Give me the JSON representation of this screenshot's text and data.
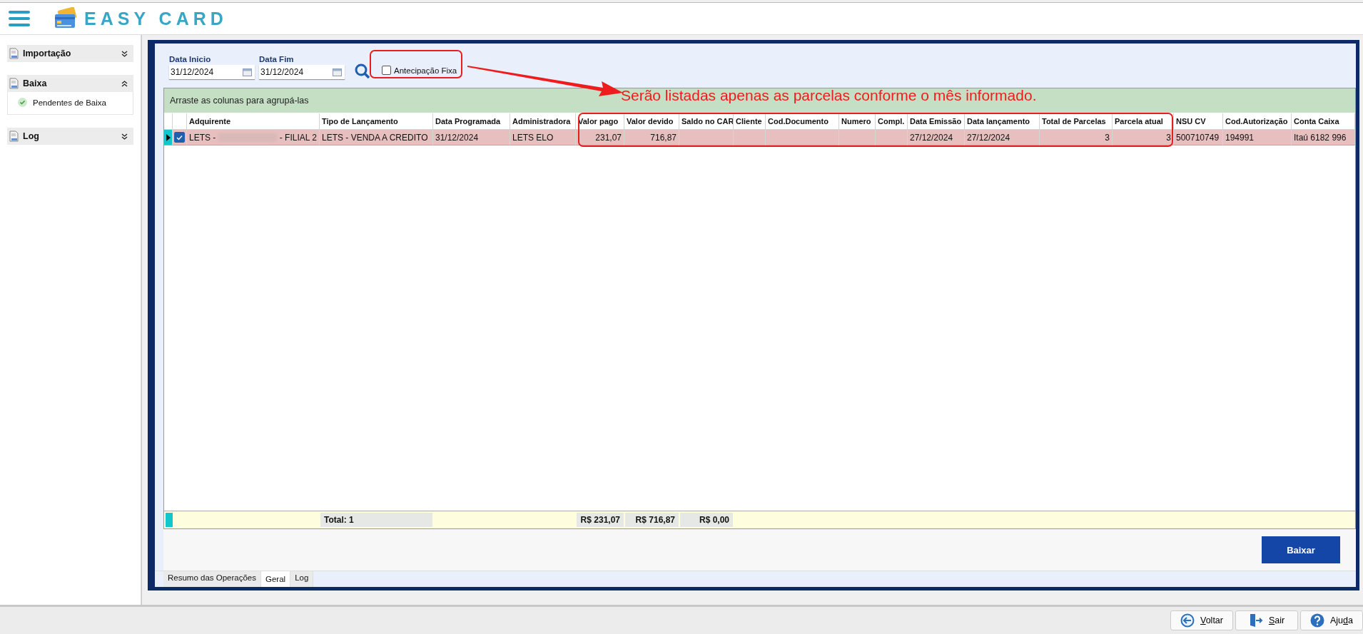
{
  "app": {
    "logo_text": "EASY CARD"
  },
  "sidebar": {
    "sections": [
      {
        "title": "Importação",
        "expanded": false
      },
      {
        "title": "Baixa",
        "expanded": true,
        "items": [
          {
            "label": "Pendentes de Baixa"
          }
        ]
      },
      {
        "title": "Log",
        "expanded": false
      }
    ]
  },
  "filters": {
    "data_inicio": {
      "label": "Data Inicio",
      "value": "31/12/2024"
    },
    "data_fim": {
      "label": "Data Fim",
      "value": "31/12/2024"
    },
    "antecipacao_fixa": {
      "label": "Antecipação Fixa",
      "checked": false
    }
  },
  "grid": {
    "group_hint": "Arraste as colunas para agrupá-las",
    "columns": [
      "Adquirente",
      "Tipo de Lançamento",
      "Data Programada",
      "Administradora",
      "Valor pago",
      "Valor devido",
      "Saldo no CAR",
      "Cliente",
      "Cod.Documento",
      "Numero",
      "Compl.",
      "Data Emissão",
      "Data lançamento",
      "Total de Parcelas",
      "Parcela atual",
      "NSU CV",
      "Cod.Autorização",
      "Conta Caixa"
    ],
    "rows": [
      {
        "selected": true,
        "checked": true,
        "cells": [
          {
            "prefix": "LETS -",
            "suffix": "- FILIAL 2"
          },
          "LETS - VENDA A CREDITO",
          "31/12/2024",
          "LETS ELO",
          "231,07",
          "716,87",
          "",
          "",
          "",
          "",
          "",
          "27/12/2024",
          "27/12/2024",
          "3",
          "3",
          "500710749",
          "194991",
          "Itaú 6182 996"
        ]
      }
    ],
    "totals": {
      "count": "Total: 1",
      "valor_pago": "R$ 231,07",
      "valor_devido": "R$ 716,87",
      "saldo": "R$ 0,00"
    }
  },
  "annotation": "Serão listadas apenas as parcelas conforme o mês informado.",
  "action_button": "Baixar",
  "tabs": [
    {
      "label": "Resumo das Operações",
      "selected": false
    },
    {
      "label": "Geral",
      "selected": true
    },
    {
      "label": "Log",
      "selected": false
    }
  ],
  "footer_buttons": [
    {
      "kind": "back",
      "key": "V",
      "after": "oltar"
    },
    {
      "kind": "exit",
      "key": "S",
      "after": "air"
    },
    {
      "kind": "help",
      "before": "Aju",
      "key": "d",
      "after": "a"
    }
  ]
}
